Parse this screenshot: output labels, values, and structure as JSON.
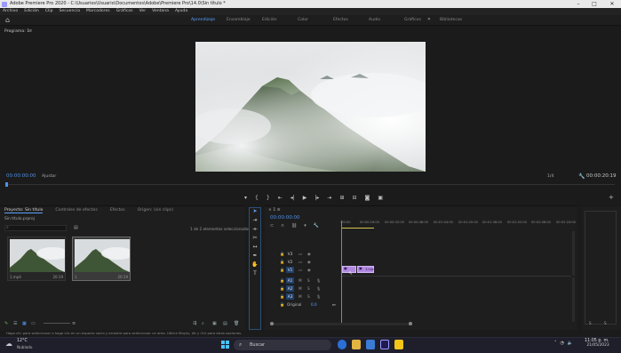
{
  "window": {
    "title": "Adobe Premiere Pro 2020 - C:\\Usuarios\\Usuario\\Documentos\\Adobe\\Premiere Pro\\14.0\\Sin título *"
  },
  "menu": [
    "Archivo",
    "Edición",
    "Clip",
    "Secuencia",
    "Marcadores",
    "Gráficos",
    "Ver",
    "Ventana",
    "Ayuda"
  ],
  "workspaces": {
    "tabs": [
      "Aprendizaje",
      "Ensamblaje",
      "Edición",
      "Color",
      "Efectos",
      "Audio",
      "Gráficos",
      "Bibliotecas"
    ],
    "active": "Aprendizaje"
  },
  "program": {
    "title": "Programa: 1",
    "timecode": "00:00:00:00",
    "fit": "Ajustar",
    "quality": "1/4",
    "duration": "00:00:20:19"
  },
  "project": {
    "tabs": [
      "Proyecto: Sin título",
      "Controles de efectos",
      "Efectos",
      "Origen: (sin clips)"
    ],
    "file": "Sin título.prproj",
    "count": "1 de 2 elementos seleccionados",
    "items": [
      {
        "name": "1.mp4",
        "duration": "20:19"
      },
      {
        "name": "1",
        "duration": "20:19"
      }
    ]
  },
  "timeline": {
    "tab": "1",
    "timecode": "00:00:00:00",
    "ruler": [
      ":00:00",
      "00:00:16:00",
      "00:00:32:00",
      "00:00:48:00",
      "00:01:04:00",
      "00:01:20:00",
      "00:01:36:00",
      "00:01:52:00",
      "00:02:08:00",
      "00:02:24:00",
      "00:"
    ],
    "video_tracks": [
      "V3",
      "V2",
      "V1"
    ],
    "audio_tracks": [
      "A1",
      "A2",
      "A3"
    ],
    "master": {
      "label": "Original",
      "value": "0.0"
    },
    "clip": {
      "label": "1.mp4"
    }
  },
  "status": "Haga clic para seleccionar o haga clic en un espacio vacío y arrastre para seleccionar un área. Utilice Mayús, Alt y Ctrl para otras opciones.",
  "taskbar": {
    "weather": {
      "temp": "12°C",
      "desc": "Nublado"
    },
    "search": "Buscar",
    "time": "11:05 p. m.",
    "date": "21/05/2023"
  },
  "colors": {
    "accent": "#4f8fe6",
    "clip": "#b28be0",
    "panel": "#1e1e1e"
  }
}
